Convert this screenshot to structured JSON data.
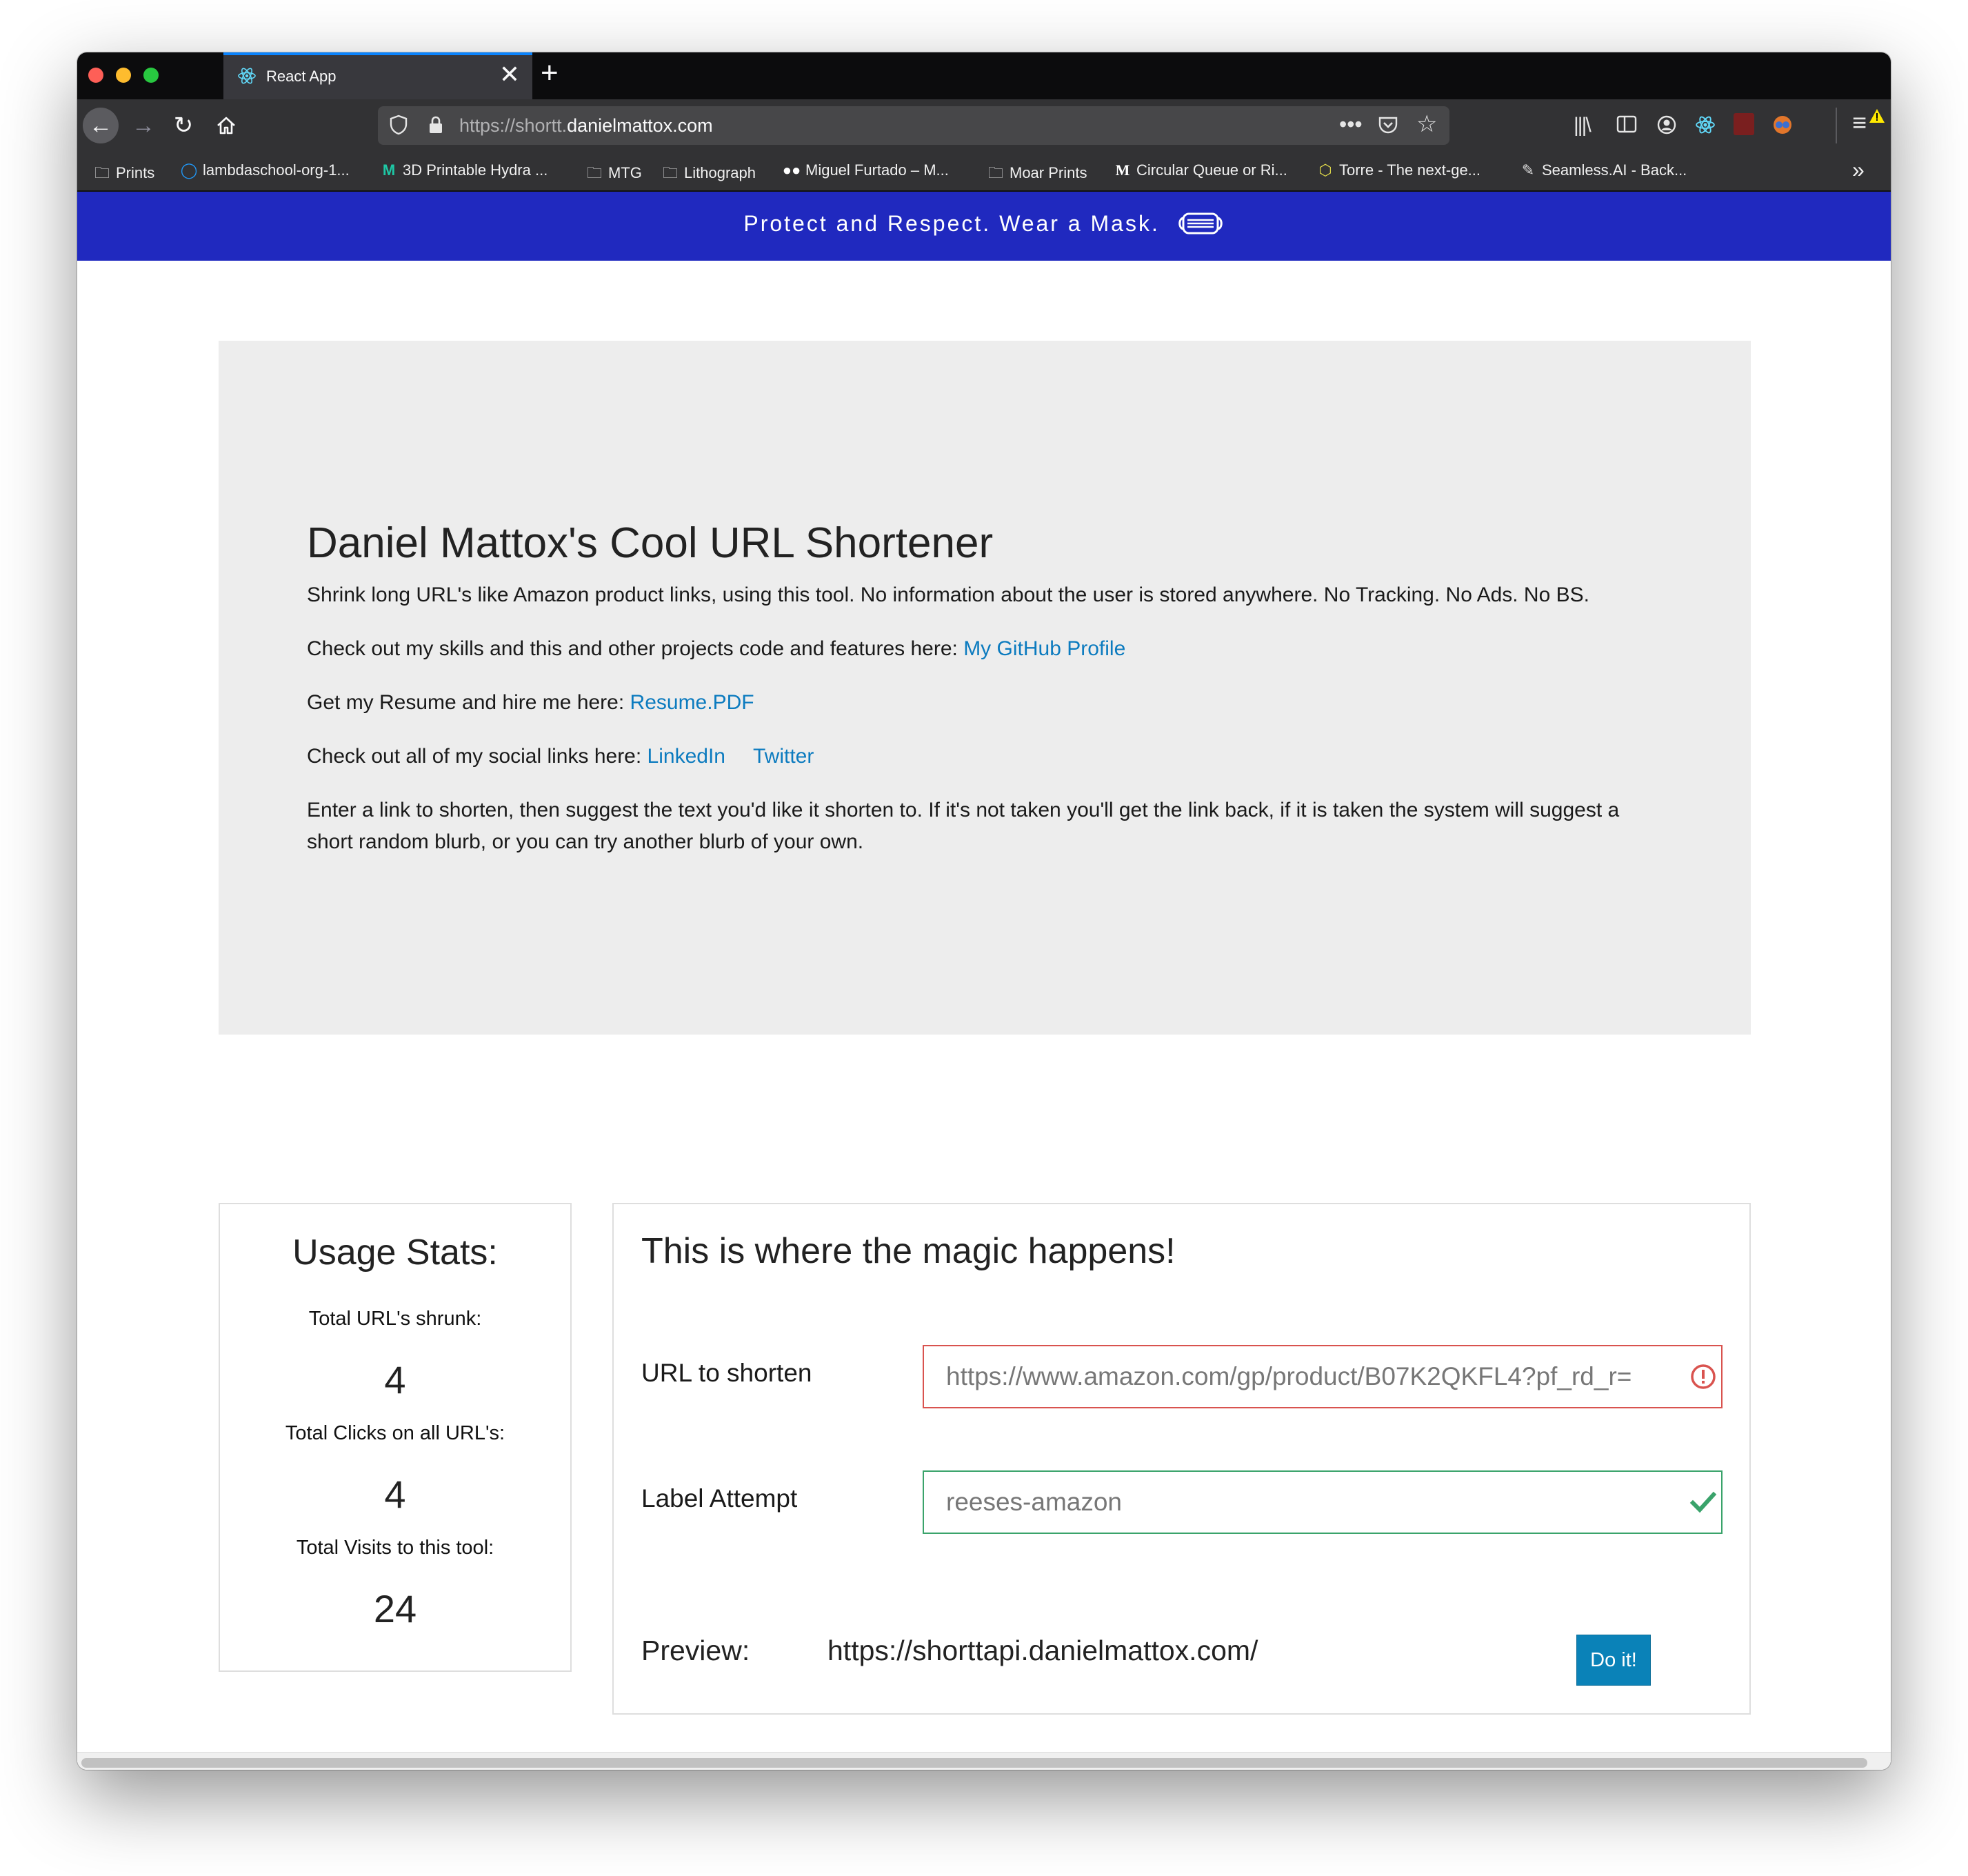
{
  "browser": {
    "tab": {
      "title": "React App",
      "close": "✕"
    },
    "new_tab": "+",
    "url_prefix": "https://shortt.",
    "url_host": "danielmattox.com"
  },
  "bookmarks": [
    {
      "icon": "folder-icon",
      "label": "Prints"
    },
    {
      "icon": "circle-icon",
      "label": "lambdaschool-org-1..."
    },
    {
      "icon": "m-logo-icon",
      "label": "3D Printable Hydra ..."
    },
    {
      "icon": "folder-icon",
      "label": "MTG"
    },
    {
      "icon": "folder-icon",
      "label": "Lithograph"
    },
    {
      "icon": "medium-icon",
      "label": "Miguel Furtado – M..."
    },
    {
      "icon": "folder-icon",
      "label": "Moar Prints"
    },
    {
      "icon": "m-bold-icon",
      "label": "Circular Queue or Ri..."
    },
    {
      "icon": "torre-icon",
      "label": "Torre - The next-ge..."
    },
    {
      "icon": "pen-icon",
      "label": "Seamless.AI - Back..."
    }
  ],
  "banner": {
    "text": "Protect and Respect. Wear a Mask."
  },
  "hero": {
    "title": "Daniel Mattox's Cool URL Shortener",
    "intro": "Shrink long URL's like Amazon product links, using this tool. No information about the user is stored anywhere. No Tracking. No Ads. No BS.",
    "github_text": "Check out my skills and this and other projects code and features here: ",
    "github_link": "My GitHub Profile",
    "resume_text": "Get my Resume and hire me here: ",
    "resume_link": "Resume.PDF",
    "social_text": "Check out all of my social links here: ",
    "linkedin_link": "LinkedIn",
    "twitter_link": "Twitter",
    "instructions": "Enter a link to shorten, then suggest the text you'd like it shorten to. If it's not taken you'll get the link back, if it is taken the system will suggest a short random blurb, or you can try another blurb of your own."
  },
  "stats": {
    "title": "Usage Stats:",
    "urls_label": "Total URL's shrunk:",
    "urls_value": "4",
    "clicks_label": "Total Clicks on all URL's:",
    "clicks_value": "4",
    "visits_label": "Total Visits to this tool:",
    "visits_value": "24"
  },
  "form": {
    "title": "This is where the magic happens!",
    "url_label": "URL to shorten",
    "url_value": "https://www.amazon.com/gp/product/B07K2QKFL4?pf_rd_r=",
    "label_label": "Label Attempt",
    "label_value": "reeses-amazon",
    "preview_label": "Preview:",
    "preview_value": "https://shorttapi.danielmattox.com/",
    "submit_label": "Do it!"
  },
  "colors": {
    "banner": "#2029bf",
    "link": "#0c7bbf",
    "error": "#d9534f",
    "success": "#3aa36b",
    "button": "#0a82b8"
  }
}
